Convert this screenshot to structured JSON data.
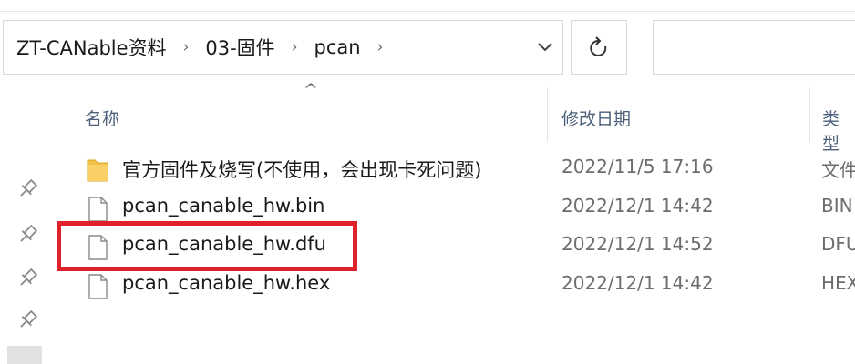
{
  "breadcrumb": [
    {
      "label": "ZT-CANable资料"
    },
    {
      "label": "03-固件"
    },
    {
      "label": "pcan"
    }
  ],
  "breadcrumb_separator": "›",
  "columns": {
    "name": "名称",
    "date": "修改日期",
    "type": "类型"
  },
  "sort_indicator": "^",
  "files": [
    {
      "name": "官方固件及烧写(不使用，会出现卡死问题)",
      "date": "2022/11/5 17:16",
      "type": "文件",
      "icon": "folder-icon"
    },
    {
      "name": "pcan_canable_hw.bin",
      "date": "2022/12/1 14:42",
      "type": "BIN",
      "icon": "file-icon"
    },
    {
      "name": "pcan_canable_hw.dfu",
      "date": "2022/12/1 14:52",
      "type": "DFU",
      "icon": "file-icon"
    },
    {
      "name": "pcan_canable_hw.hex",
      "date": "2022/12/1 14:42",
      "type": "HEX",
      "icon": "file-icon"
    }
  ],
  "colors": {
    "highlight": "#e0202b",
    "header_text": "#4c607a",
    "folder": "#f4c246"
  }
}
